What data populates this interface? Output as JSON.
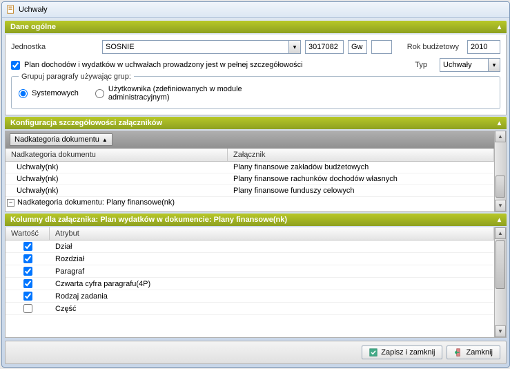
{
  "window": {
    "title": "Uchwały"
  },
  "sections": {
    "general": {
      "title": "Dane ogólne",
      "labels": {
        "jednostka": "Jednostka",
        "rok": "Rok budżetowy",
        "typ": "Typ"
      },
      "values": {
        "jednostka": "SOŚNIE",
        "num1": "3017082",
        "num2": "Gw",
        "num3": "",
        "rok": "2010",
        "typ": "Uchwały"
      },
      "checkbox_label": "Plan dochodów i wydatków w uchwałach prowadzony jest w pełnej szczegółowości",
      "fieldset_legend": "Grupuj paragrafy używając grup:",
      "radio1": "Systemowych",
      "radio2": "Użytkownika (zdefiniowanych w module administracyjnym)"
    },
    "config": {
      "title": "Konfiguracja szczegółowości załączników",
      "group_by": "Nadkategoria dokumentu",
      "columns": {
        "nk": "Nadkategoria dokumentu",
        "zl": "Załącznik"
      },
      "rows": [
        {
          "nk": "Uchwały(nk)",
          "zl": "Plany finansowe zakładów budżetowych"
        },
        {
          "nk": "Uchwały(nk)",
          "zl": "Plany finansowe rachunków dochodów własnych"
        },
        {
          "nk": "Uchwały(nk)",
          "zl": "Plany finansowe funduszy celowych"
        }
      ],
      "group_row": "Nadkategoria dokumentu:  Plany finansowe(nk)"
    },
    "columns": {
      "title": "Kolumny dla załącznika: Plan wydatków w dokumencie: Plany finansowe(nk)",
      "headers": {
        "wartosc": "Wartość",
        "atrybut": "Atrybut"
      },
      "rows": [
        {
          "checked": true,
          "attr": "Dział"
        },
        {
          "checked": true,
          "attr": "Rozdział"
        },
        {
          "checked": true,
          "attr": "Paragraf"
        },
        {
          "checked": true,
          "attr": "Czwarta cyfra paragrafu(4P)"
        },
        {
          "checked": true,
          "attr": "Rodzaj zadania"
        },
        {
          "checked": false,
          "attr": "Część"
        }
      ]
    }
  },
  "footer": {
    "save": "Zapisz i zamknij",
    "close": "Zamknij"
  }
}
